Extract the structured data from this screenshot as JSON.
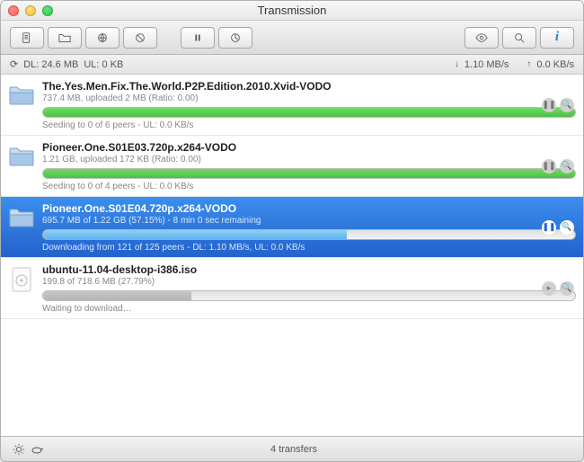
{
  "window": {
    "title": "Transmission"
  },
  "stats": {
    "dl": "DL: 24.6 MB",
    "ul": "UL: 0 KB",
    "dlrate": "1.10 MB/s",
    "ulrate": "0.0 KB/s"
  },
  "torrents": [
    {
      "name": "The.Yes.Men.Fix.The.World.P2P.Edition.2010.Xvid-VODO",
      "sub": "737.4 MB, uploaded 2 MB (Ratio: 0.00)",
      "status": "Seeding to 0 of 6 peers - UL: 0.0 KB/s",
      "progress": 100,
      "fill": "green",
      "selected": false,
      "icon": "folder",
      "paused": false
    },
    {
      "name": "Pioneer.One.S01E03.720p.x264-VODO",
      "sub": "1.21 GB, uploaded 172 KB (Ratio: 0.00)",
      "status": "Seeding to 0 of 4 peers - UL: 0.0 KB/s",
      "progress": 100,
      "fill": "green",
      "selected": false,
      "icon": "folder",
      "paused": false
    },
    {
      "name": "Pioneer.One.S01E04.720p.x264-VODO",
      "sub": "695.7 MB of 1.22 GB (57.15%) - 8 min 0 sec remaining",
      "status": "Downloading from 121 of 125 peers - DL: 1.10 MB/s, UL: 0.0 KB/s",
      "progress": 57.15,
      "fill": "blue",
      "selected": true,
      "icon": "folder",
      "paused": false
    },
    {
      "name": "ubuntu-11.04-desktop-i386.iso",
      "sub": "199.8 of 718.6 MB (27.79%)",
      "status": "Waiting to download…",
      "progress": 27.79,
      "fill": "gray",
      "selected": false,
      "icon": "iso",
      "paused": true
    }
  ],
  "footer": {
    "label": "4 transfers"
  }
}
